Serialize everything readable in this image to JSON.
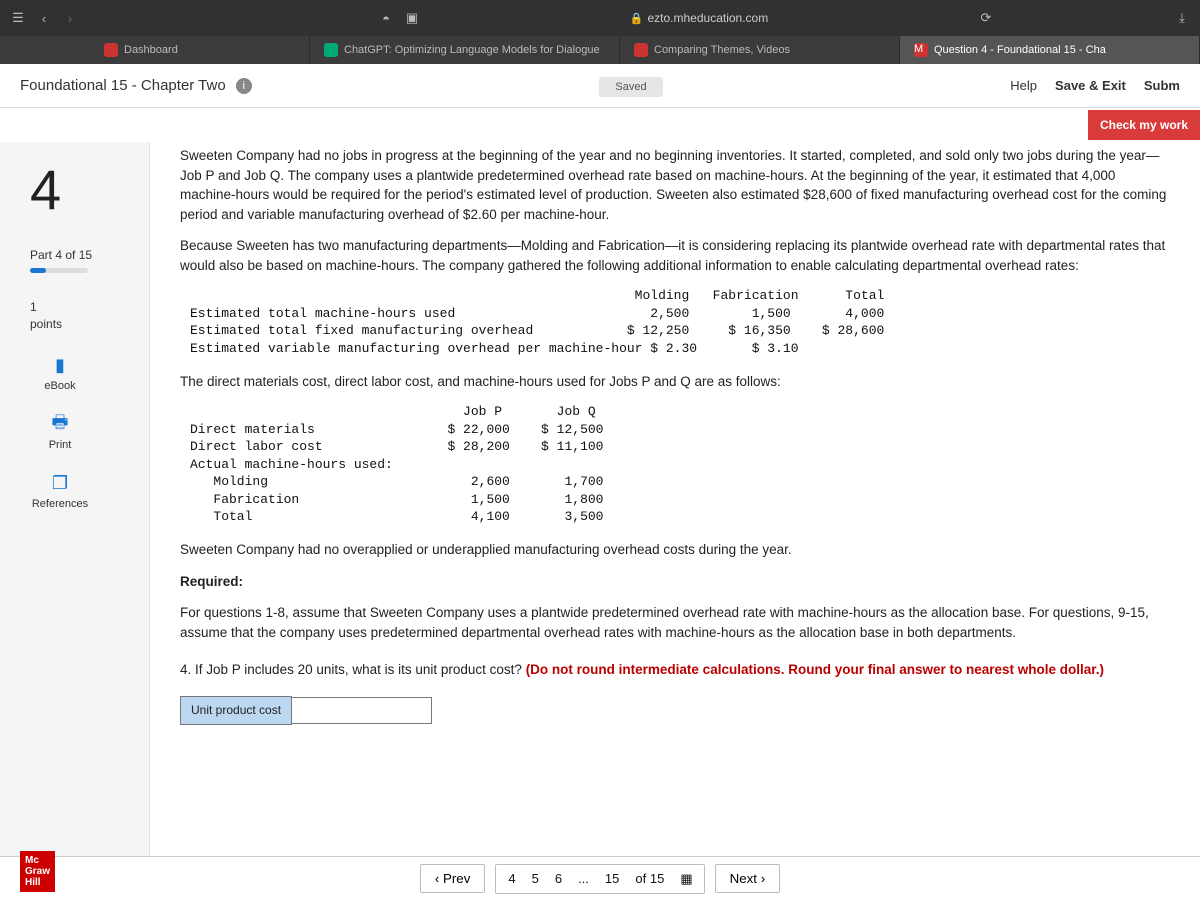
{
  "browser": {
    "url_host": "ezto.mheducation.com"
  },
  "tabs": [
    {
      "label": "Dashboard"
    },
    {
      "label": "ChatGPT: Optimizing Language Models for Dialogue"
    },
    {
      "label": "Comparing Themes, Videos"
    },
    {
      "label": "Question 4 - Foundational 15 - Cha"
    }
  ],
  "appbar": {
    "title": "Foundational 15 - Chapter Two",
    "saved": "Saved",
    "help": "Help",
    "save_exit": "Save & Exit",
    "submit": "Subm"
  },
  "check_btn": "Check my work",
  "sidebar": {
    "number": "4",
    "part": "Part 4 of 15",
    "points_num": "1",
    "points_lbl": "points",
    "ebook": "eBook",
    "print": "Print",
    "references": "References"
  },
  "body": {
    "p1": "Sweeten Company had no jobs in progress at the beginning of the year and no beginning inventories. It started, completed, and sold only two jobs during the year—Job P and Job Q. The company uses a plantwide predetermined overhead rate based on machine-hours. At the beginning of the year, it estimated that 4,000 machine-hours would be required for the period's estimated level of production. Sweeten also estimated $28,600 of fixed manufacturing overhead cost for the coming period and variable manufacturing overhead of $2.60 per machine-hour.",
    "p2": "Because Sweeten has two manufacturing departments—Molding and Fabrication—it is considering replacing its plantwide overhead rate with departmental rates that would also be based on machine-hours. The company gathered the following additional information to enable calculating departmental overhead rates:",
    "dept_table": "                                                         Molding   Fabrication      Total\nEstimated total machine-hours used                         2,500        1,500       4,000\nEstimated total fixed manufacturing overhead            $ 12,250     $ 16,350    $ 28,600\nEstimated variable manufacturing overhead per machine-hour $ 2.30       $ 3.10",
    "p3": "The direct materials cost, direct labor cost, and machine-hours used for Jobs P and Q are as follows:",
    "job_table": "                                   Job P       Job Q\nDirect materials                 $ 22,000    $ 12,500\nDirect labor cost                $ 28,200    $ 11,100\nActual machine-hours used:\n   Molding                          2,600       1,700\n   Fabrication                      1,500       1,800\n   Total                            4,100       3,500",
    "p4": "Sweeten Company had no overapplied or underapplied manufacturing overhead costs during the year.",
    "req_head": "Required:",
    "req": "For questions 1-8, assume that Sweeten Company uses a plantwide predetermined overhead rate with machine-hours as the allocation base. For questions, 9-15, assume that the company uses predetermined departmental overhead rates with machine-hours as the allocation base in both departments.",
    "q4a": "4. If Job P includes 20 units, what is its unit product cost? ",
    "q4b": "(Do not round intermediate calculations. Round your final answer to nearest whole dollar.)",
    "answer_label": "Unit product cost"
  },
  "pager": {
    "prev": "Prev",
    "nums": [
      "4",
      "5",
      "6",
      "...",
      "15"
    ],
    "of": "of 15",
    "next": "Next"
  },
  "logo": {
    "l1": "Mc",
    "l2": "Graw",
    "l3": "Hill"
  }
}
